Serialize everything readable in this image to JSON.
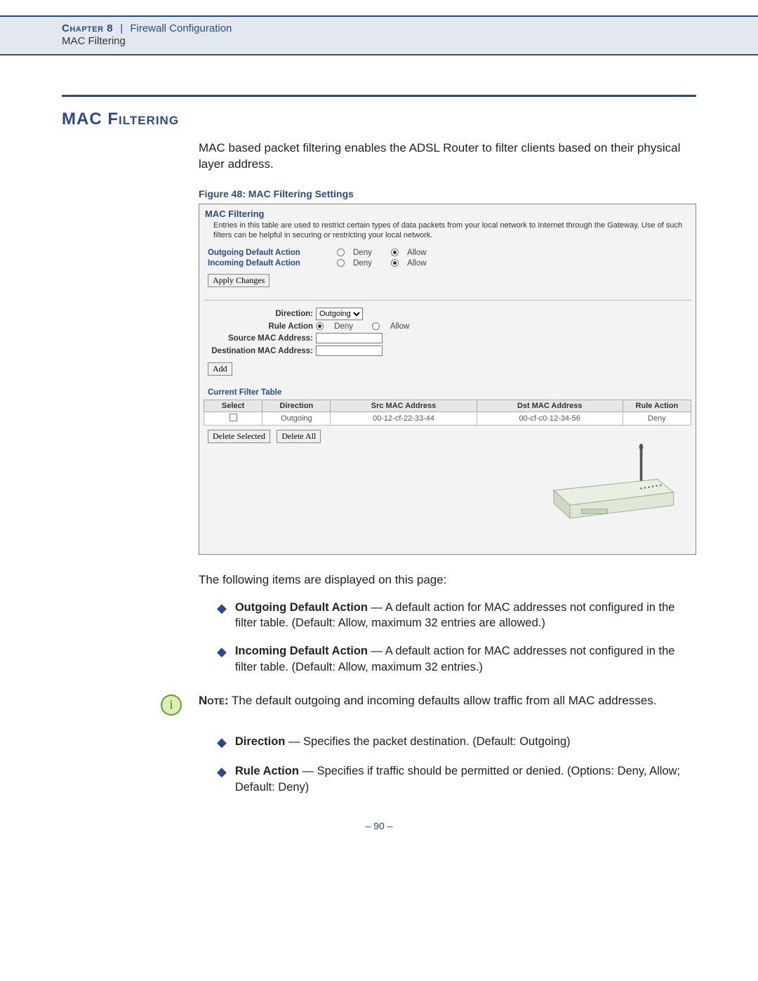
{
  "header": {
    "chapter_label": "Chapter 8",
    "separator": "|",
    "section": "Firewall Configuration",
    "subsection": "MAC Filtering"
  },
  "title": "MAC Filtering",
  "intro": "MAC based packet filtering enables the ADSL Router to filter clients based on their physical layer address.",
  "figure_caption": "Figure 48:  MAC Filtering Settings",
  "screenshot": {
    "panel_title": "MAC Filtering",
    "description": "Entries in this table are used to restrict certain types of data packets from your local network to Internet through the Gateway. Use of such filters can be helpful in securing or restricting your local network.",
    "outgoing_label": "Outgoing Default Action",
    "incoming_label": "Incoming Default Action",
    "deny_label": "Deny",
    "allow_label": "Allow",
    "outgoing_selected": "Allow",
    "incoming_selected": "Allow",
    "apply_btn": "Apply Changes",
    "direction_label": "Direction:",
    "direction_value": "Outgoing",
    "rule_action_label": "Rule Action",
    "rule_action_selected": "Deny",
    "src_mac_label": "Source MAC Address:",
    "dst_mac_label": "Destination MAC Address:",
    "add_btn": "Add",
    "table_heading": "Current Filter Table",
    "columns": {
      "select": "Select",
      "direction": "Direction",
      "src": "Src MAC Address",
      "dst": "Dst MAC Address",
      "action": "Rule Action"
    },
    "rows": [
      {
        "direction": "Outgoing",
        "src": "00-12-cf-22-33-44",
        "dst": "00-cf-c0-12-34-56",
        "action": "Deny"
      }
    ],
    "delete_selected_btn": "Delete Selected",
    "delete_all_btn": "Delete All"
  },
  "lead_text": "The following items are displayed on this page:",
  "items1": [
    {
      "term": "Outgoing Default Action",
      "desc": " — A default action for MAC addresses not configured in the filter table. (Default: Allow, maximum 32 entries are allowed.)"
    },
    {
      "term": "Incoming Default Action",
      "desc": " — A default action for MAC addresses not configured in the filter table. (Default: Allow, maximum 32 entries.)"
    }
  ],
  "note": {
    "label": "Note:",
    "text": " The default outgoing and incoming defaults allow traffic from all MAC addresses."
  },
  "items2": [
    {
      "term": "Direction",
      "desc": " — Specifies the packet destination. (Default: Outgoing)"
    },
    {
      "term": "Rule Action",
      "desc": " — Specifies if traffic should be permitted or denied. (Options: Deny, Allow; Default: Deny)"
    }
  ],
  "page_number": "–  90  –"
}
